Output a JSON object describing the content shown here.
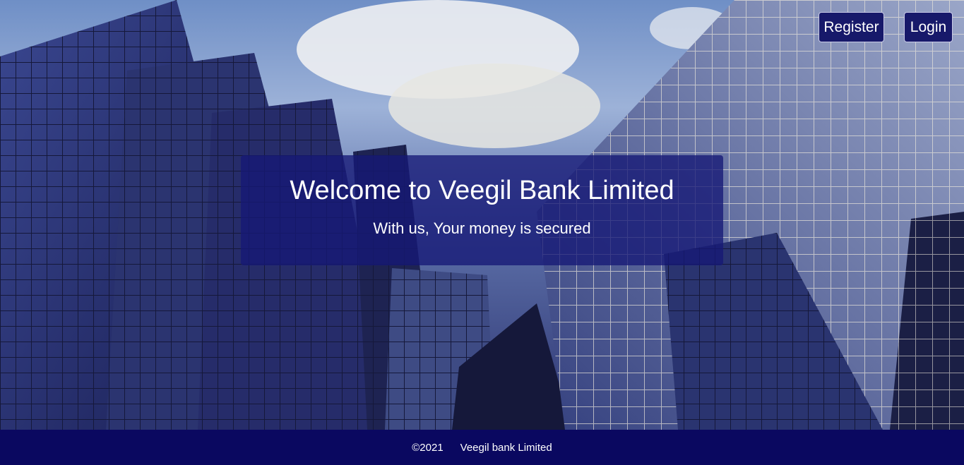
{
  "nav": {
    "register_label": "Register",
    "login_label": "Login"
  },
  "hero": {
    "title": "Welcome to Veegil Bank Limited",
    "subtitle": "With us, Your money is secured"
  },
  "footer": {
    "copyright": "©2021",
    "company": "Veegil bank Limited"
  },
  "colors": {
    "nav_button_bg": "#17196a",
    "welcome_box_bg": "#161876",
    "footer_bg": "#0a0860"
  }
}
